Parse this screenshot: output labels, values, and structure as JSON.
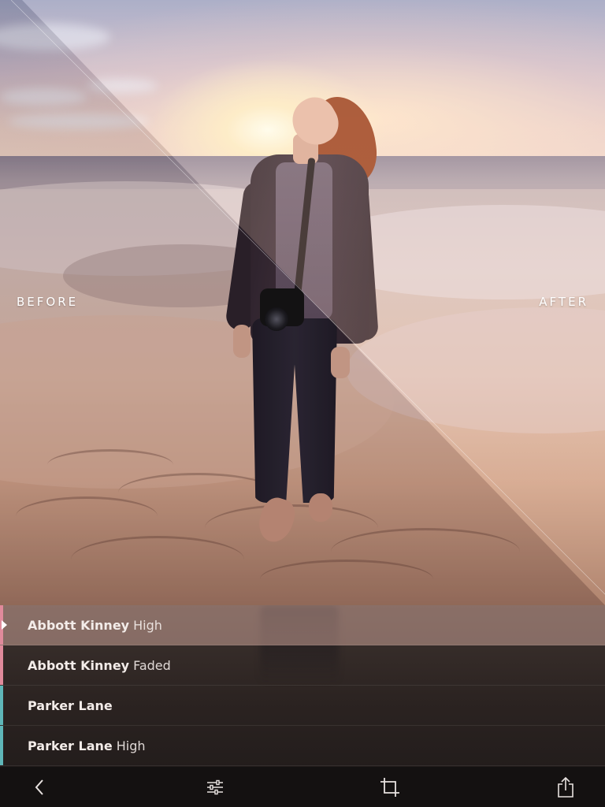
{
  "photo": {
    "label_before": "BEFORE",
    "label_after": "AFTER",
    "split": "diagonal"
  },
  "filters": [
    {
      "name": "Abbott Kinney",
      "variant": "High",
      "active": true,
      "stripe_color": "#e08a9b"
    },
    {
      "name": "Abbott Kinney",
      "variant": "Faded",
      "active": false,
      "stripe_color": "#e08a9b"
    },
    {
      "name": "Parker Lane",
      "variant": "",
      "active": false,
      "stripe_color": "#5fb6b8"
    },
    {
      "name": "Parker Lane",
      "variant": "High",
      "active": false,
      "stripe_color": "#5fb6b8"
    }
  ],
  "toolbar": {
    "back": "back-icon",
    "adjust": "sliders-icon",
    "crop": "crop-icon",
    "share": "share-icon"
  },
  "colors": {
    "active_row": "#c8a096",
    "list_bg": "#2b2321",
    "toolbar_bg": "#141111",
    "text": "#f3ece9"
  }
}
